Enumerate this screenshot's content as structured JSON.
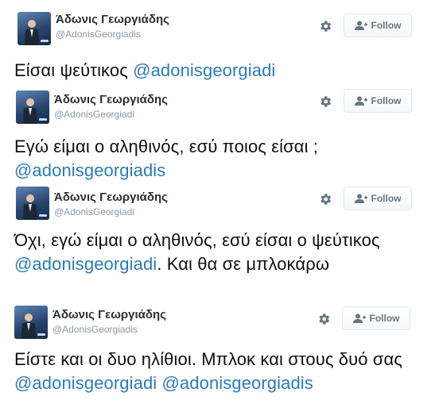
{
  "tweets": [
    {
      "name": "Άδωνις Γεωργιάδης",
      "handle": "@AdonisGeorgiadis",
      "follow_label": "Follow",
      "text": "Είσαι ψεύτικος ",
      "mentions": [
        "@adonisgeorgiadi"
      ]
    },
    {
      "name": "Άδωνις Γεωργιάδης",
      "handle": "@AdonisGeorgiadi",
      "follow_label": "Follow",
      "text": "Εγώ είμαι ο αληθινός, εσύ ποιος είσαι ;",
      "mentions": [
        "@adonisgeorgiadis"
      ]
    },
    {
      "name": "Άδωνις Γεωργιάδης",
      "handle": "@AdonisGeorgiadi",
      "follow_label": "Follow",
      "text_before": "Όχι, εγώ είμαι ο αληθινός, εσύ είσαι ο ψεύτικος ",
      "mention": "@adonisgeorgiadi",
      "text_after": ". Και θα σε μπλοκάρω"
    },
    {
      "name": "Άδωνις Γεωργιάδης",
      "handle": "@AdonisGeorgiadis",
      "follow_label": "Follow",
      "text": "Είστε και οι δυο ηλίθιοι. Μπλοκ και στους δυό σας ",
      "mentions": [
        "@adonisgeorgiadi",
        "@adonisgeorgiadis"
      ]
    }
  ],
  "colors": {
    "mention": "#2b7bb9",
    "name": "#292f33",
    "handle": "#8899a6",
    "follow_text": "#66757f",
    "follow_border": "#e1e8ed"
  }
}
